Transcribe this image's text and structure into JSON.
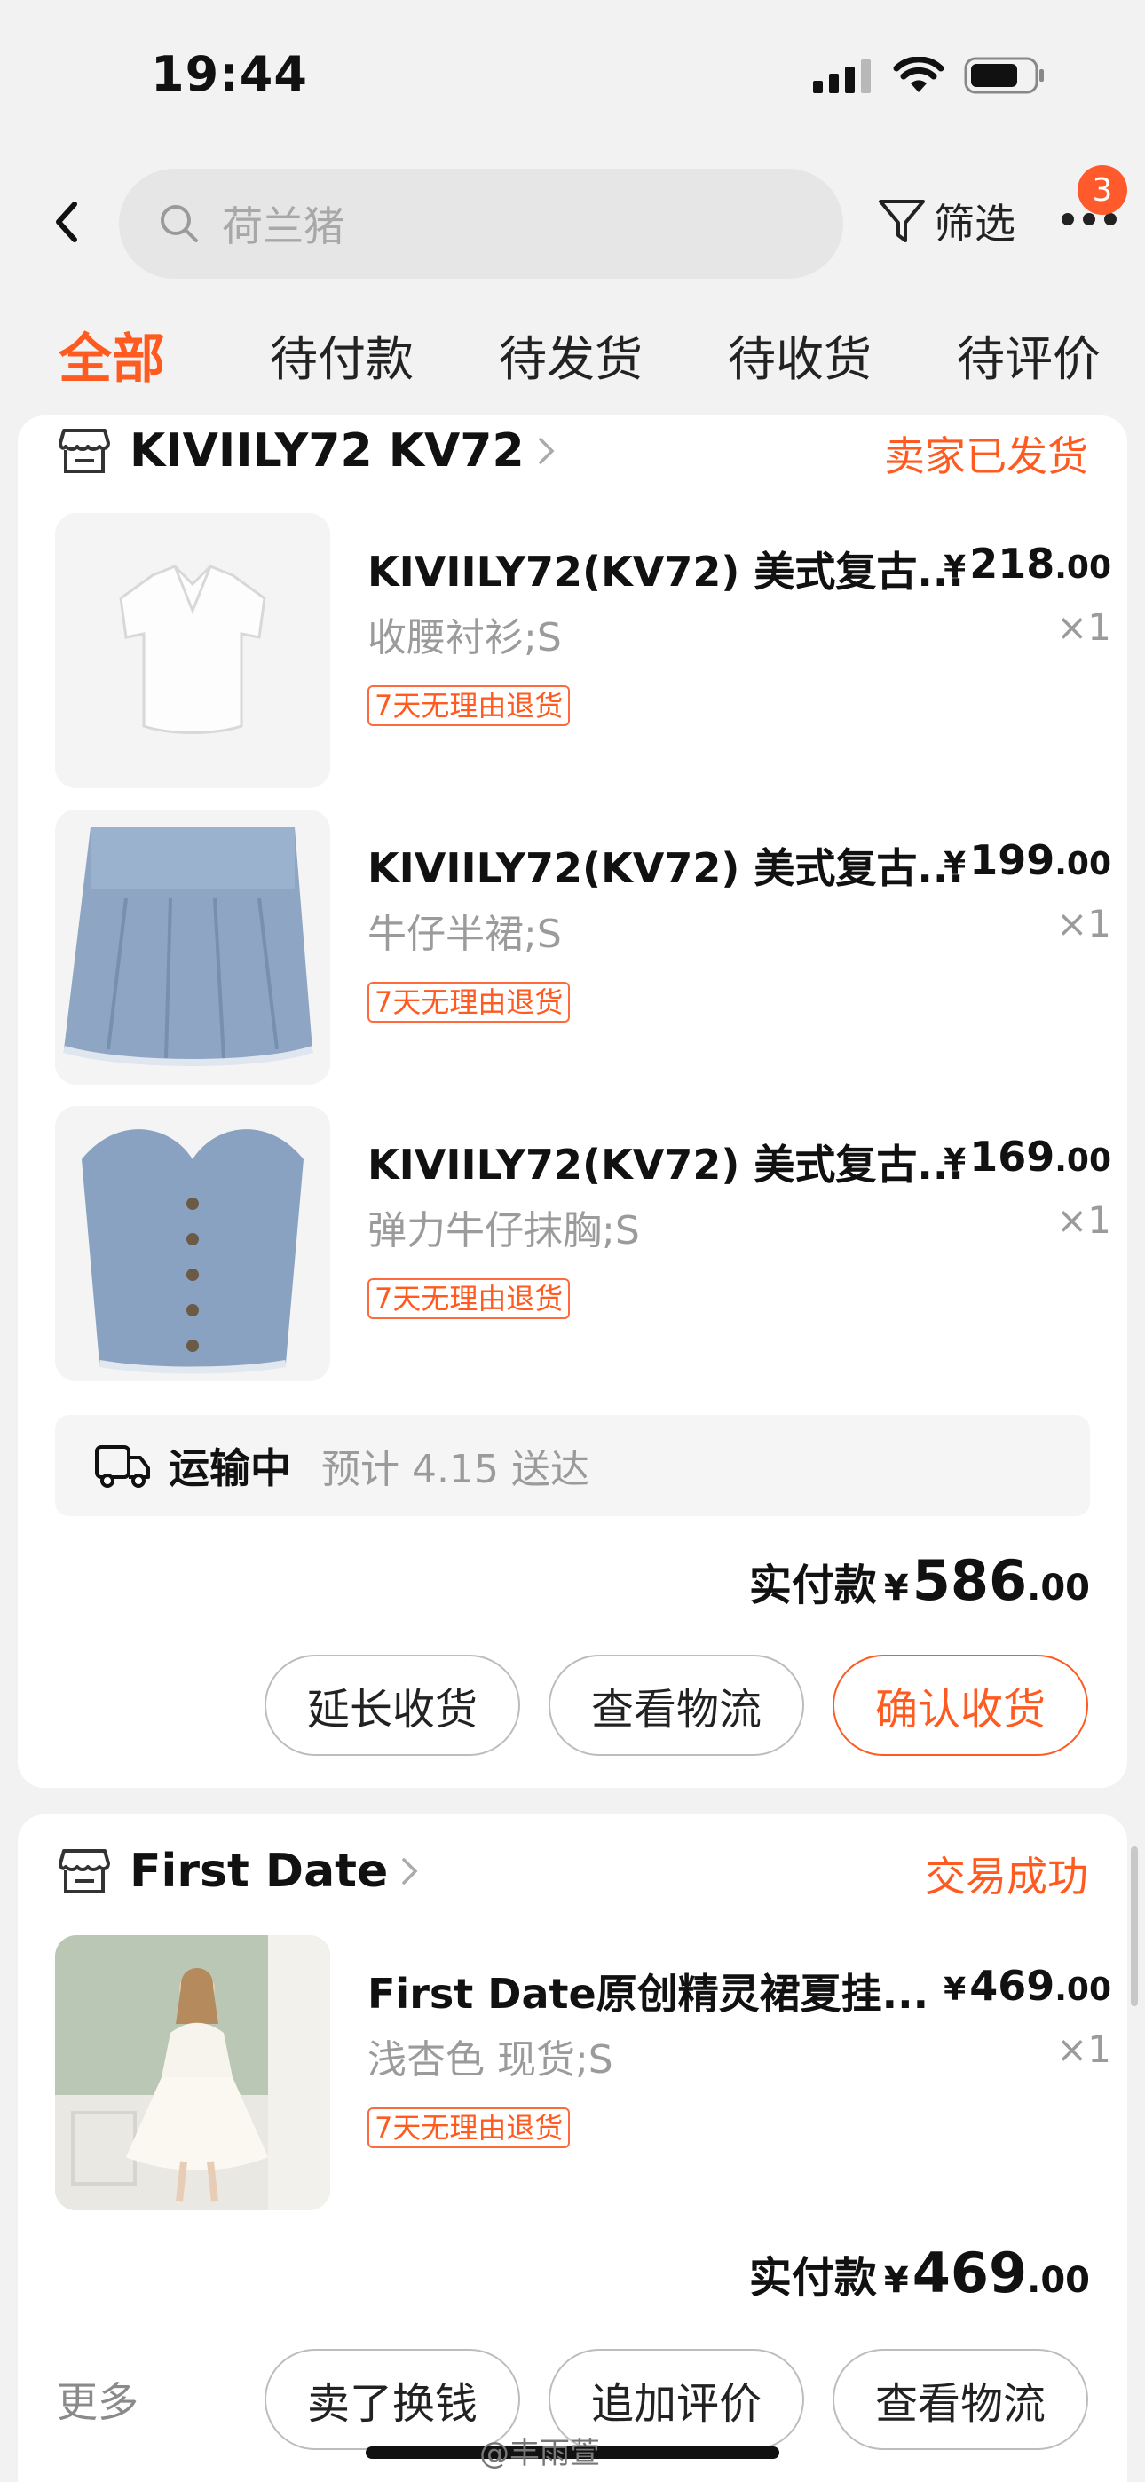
{
  "status_bar": {
    "time": "19:44"
  },
  "header": {
    "search_placeholder": "荷兰猪",
    "filter_label": "筛选",
    "more_badge_count": "3"
  },
  "tabs": [
    {
      "label": "全部",
      "active": true
    },
    {
      "label": "待付款"
    },
    {
      "label": "待发货"
    },
    {
      "label": "待收货"
    },
    {
      "label": "待评价"
    }
  ],
  "orders": [
    {
      "shop_name": "KIVIILY72 KV72",
      "status": "卖家已发货",
      "items": [
        {
          "title": "KIVIILY72(KV72) 美式复古...",
          "price_int": "218",
          "price_dec": ".00",
          "currency": "¥",
          "spec": "收腰衬衫;S",
          "qty": "×1",
          "tag": "7天无理由退货",
          "thumb_icon": "white-blouse-image"
        },
        {
          "title": "KIVIILY72(KV72) 美式复古...",
          "price_int": "199",
          "price_dec": ".00",
          "currency": "¥",
          "spec": "牛仔半裙;S",
          "qty": "×1",
          "tag": "7天无理由退货",
          "thumb_icon": "denim-skirt-image"
        },
        {
          "title": "KIVIILY72(KV72) 美式复古...",
          "price_int": "169",
          "price_dec": ".00",
          "currency": "¥",
          "spec": "弹力牛仔抹胸;S",
          "qty": "×1",
          "tag": "7天无理由退货",
          "thumb_icon": "denim-bustier-image"
        }
      ],
      "logistics": {
        "label": "运输中",
        "eta": "预计 4.15 送达"
      },
      "total_label": "实付款",
      "total_currency": "¥",
      "total_int": "586",
      "total_dec": ".00",
      "buttons": [
        "延长收货",
        "查看物流",
        "确认收货"
      ]
    },
    {
      "shop_name": "First Date",
      "status": "交易成功",
      "items": [
        {
          "title": "First Date原创精灵裙夏挂...",
          "price_int": "469",
          "price_dec": ".00",
          "currency": "¥",
          "spec": "浅杏色 现货;S",
          "qty": "×1",
          "tag": "7天无理由退货",
          "thumb_icon": "white-dress-photo"
        }
      ],
      "total_label": "实付款",
      "total_currency": "¥",
      "total_int": "469",
      "total_dec": ".00",
      "more_label": "更多",
      "buttons": [
        "卖了换钱",
        "追加评价",
        "查看物流"
      ]
    }
  ],
  "watermark": "@丰雨萱"
}
